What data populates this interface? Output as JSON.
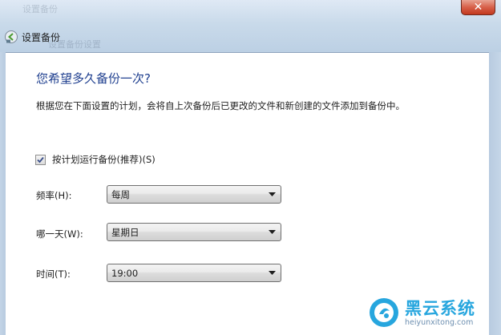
{
  "window": {
    "ghost_title": "设置备份",
    "ghost_subtitle": "设置备份设置",
    "close_label": "✕",
    "nav_title": "设置备份"
  },
  "content": {
    "heading": "您希望多久备份一次?",
    "description": "根据您在下面设置的计划，会将自上次备份后已更改的文件和新创建的文件添加到备份中。",
    "schedule_checkbox": {
      "label": "按计划运行备份(推荐)(S)",
      "checked": true
    },
    "frequency": {
      "label": "频率(H):",
      "value": "每周"
    },
    "day": {
      "label": "哪一天(W):",
      "value": "星期日"
    },
    "time": {
      "label": "时间(T):",
      "value": "19:00"
    }
  },
  "watermark": {
    "brand_cn": "黑云系统",
    "brand_url": "heiyunxitong.com"
  },
  "colors": {
    "heading": "#1f3f8f",
    "close_button": "#c2391f",
    "watermark": "#27a6de"
  }
}
